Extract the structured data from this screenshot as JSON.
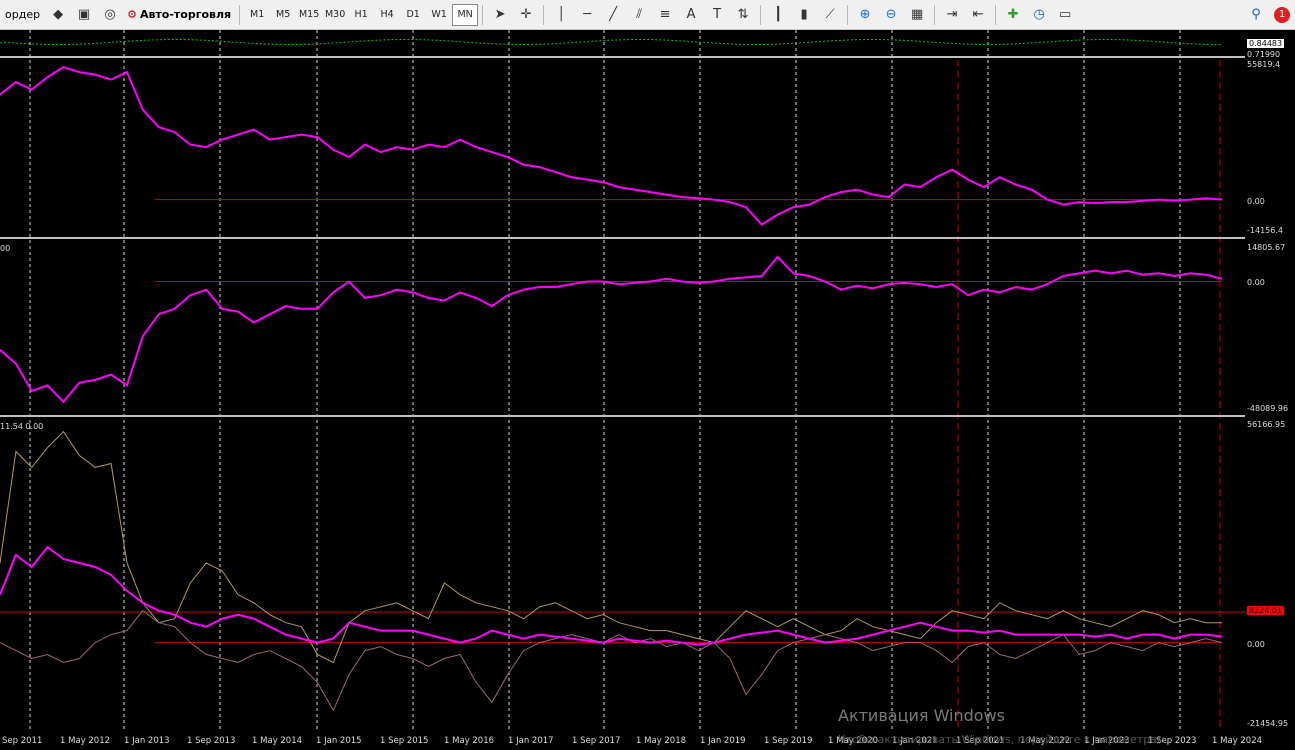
{
  "toolbar": {
    "new_order_label": "ордер",
    "auto_trading_label": "Авто-торговля",
    "timeframes": [
      "M1",
      "M5",
      "M15",
      "M30",
      "H1",
      "H4",
      "D1",
      "W1",
      "MN"
    ],
    "active_timeframe": "MN",
    "notification_count": "1"
  },
  "panes": [
    {
      "id": "pane0",
      "axis_labels": [
        "0.84483",
        "0.71990"
      ]
    },
    {
      "id": "pane1",
      "axis_labels": [
        "55819.4",
        "0.00",
        "-14156.4"
      ]
    },
    {
      "id": "pane2",
      "corner": "00",
      "axis_labels": [
        "14805.67",
        "0.00",
        "-48089.96"
      ]
    },
    {
      "id": "pane3",
      "corner": "11.54 0.00",
      "axis_labels": [
        "56166.95",
        "8224.01",
        "0.00",
        "-21454.95"
      ]
    }
  ],
  "time_axis": [
    "Sep 2011",
    "1 May 2012",
    "1 Jan 2013",
    "1 Sep 2013",
    "1 May 2014",
    "1 Jan 2015",
    "1 Sep 2015",
    "1 May 2016",
    "1 Jan 2017",
    "1 Sep 2017",
    "1 May 2018",
    "1 Jan 2019",
    "1 Sep 2019",
    "1 May 2020",
    "1 Jan 2021",
    "1 Sep 2021",
    "1 May 2022",
    "1 Jan 2023",
    "1 Sep 2023",
    "1 May 2024"
  ],
  "watermark": {
    "title": "Активация Windows",
    "subtitle": "Чтобы активировать Windows, перейдите к параметрам."
  },
  "colors": {
    "main_line": "#ff00ff",
    "zero_line": "#cc0000",
    "grid": "#ffffff",
    "signal_line": "#00cc00",
    "aux_line_1": "#b39a5a",
    "aux_line_2": "#9c6a6a",
    "marker_line": "#cc0000"
  },
  "chart_data": [
    {
      "type": "line",
      "pane": "pane1",
      "x": [
        "Jul 2011",
        "Sep 2011",
        "Nov 2011",
        "Jan 2012",
        "Mar 2012",
        "May 2012",
        "Jul 2012",
        "Sep 2012",
        "Nov 2012",
        "Jan 2013",
        "Mar 2013",
        "May 2013",
        "Jul 2013",
        "Sep 2013",
        "Nov 2013",
        "Jan 2014",
        "Mar 2014",
        "May 2014",
        "Jul 2014",
        "Sep 2014",
        "Nov 2014",
        "Jan 2015",
        "Mar 2015",
        "May 2015",
        "Jul 2015",
        "Sep 2015",
        "Nov 2015",
        "Jan 2016",
        "Mar 2016",
        "May 2016",
        "Jul 2016",
        "Sep 2016",
        "Nov 2016",
        "Jan 2017",
        "Mar 2017",
        "May 2017",
        "Jul 2017",
        "Sep 2017",
        "Nov 2017",
        "Jan 2018",
        "Mar 2018",
        "May 2018",
        "Jul 2018",
        "Sep 2018",
        "Nov 2018",
        "Jan 2019",
        "Mar 2019",
        "May 2019",
        "Jul 2019",
        "Sep 2019",
        "Nov 2019",
        "Jan 2020",
        "Mar 2020",
        "May 2020",
        "Jul 2020",
        "Sep 2020",
        "Nov 2020",
        "Jan 2021",
        "Mar 2021",
        "May 2021",
        "Jul 2021",
        "Sep 2021",
        "Nov 2021",
        "Jan 2022",
        "Mar 2022",
        "May 2022",
        "Jul 2022",
        "Sep 2022",
        "Nov 2022",
        "Jan 2023",
        "Mar 2023",
        "May 2023",
        "Jul 2023",
        "Sep 2023",
        "Nov 2023",
        "Jan 2024",
        "Mar 2024",
        "May 2024"
      ],
      "values": [
        42000,
        47000,
        44000,
        49000,
        53000,
        51000,
        50000,
        48000,
        51000,
        36000,
        29000,
        27000,
        22000,
        21000,
        24000,
        26000,
        28000,
        24000,
        25000,
        26000,
        25000,
        20000,
        17000,
        22000,
        19000,
        21000,
        20000,
        22000,
        21000,
        24000,
        21000,
        19000,
        17000,
        14000,
        13000,
        11000,
        9000,
        8000,
        7000,
        5000,
        4000,
        3000,
        2000,
        1000,
        500,
        0,
        -1000,
        -3000,
        -10000,
        -6000,
        -3000,
        -2000,
        1000,
        3000,
        4000,
        2000,
        1000,
        6000,
        5000,
        9000,
        12000,
        8000,
        5000,
        9000,
        6000,
        4000,
        0,
        -2000,
        -1000,
        -1500,
        -1000,
        -1000,
        -500,
        0,
        -500,
        0,
        500,
        0
      ],
      "ylim": [
        -14156.4,
        55819.4
      ]
    },
    {
      "type": "line",
      "pane": "pane2",
      "values": [
        -25000,
        -30000,
        -40000,
        -38000,
        -44000,
        -37000,
        -36000,
        -34000,
        -38000,
        -20000,
        -12000,
        -10000,
        -5000,
        -3000,
        -10000,
        -11000,
        -15000,
        -12000,
        -9000,
        -10000,
        -10000,
        -4000,
        0,
        -6000,
        -5000,
        -3000,
        -4000,
        -6000,
        -7000,
        -4000,
        -6000,
        -9000,
        -5000,
        -3000,
        -2000,
        -2000,
        -1000,
        0,
        0,
        -1000,
        -500,
        0,
        1000,
        0,
        -500,
        0,
        1000,
        1500,
        2000,
        9000,
        3000,
        2000,
        0,
        -3000,
        -1500,
        -2500,
        -1000,
        -500,
        -1000,
        -2000,
        -1000,
        -5000,
        -3000,
        -4000,
        -2000,
        -3000,
        -1000,
        2000,
        3000,
        4000,
        3000,
        4000,
        2500,
        3000,
        2000,
        3000,
        2500,
        1000
      ],
      "ylim": [
        -48089.96,
        14805.67
      ]
    },
    {
      "type": "line",
      "pane": "pane3",
      "series_colors": [
        "#b39a5a",
        "#9c6a6a",
        "#ff00ff"
      ],
      "series": [
        {
          "values": [
            20000,
            48000,
            44000,
            49000,
            53000,
            47000,
            44000,
            45000,
            20000,
            10000,
            5000,
            6000,
            15000,
            20000,
            18000,
            12000,
            10000,
            7000,
            5000,
            4000,
            -3000,
            -5000,
            5000,
            8000,
            9000,
            10000,
            8000,
            6000,
            15000,
            12000,
            10000,
            9000,
            8000,
            6000,
            9000,
            10000,
            8000,
            6000,
            7000,
            5000,
            4000,
            3000,
            3000,
            2000,
            1000,
            0,
            4000,
            8000,
            6000,
            4000,
            6000,
            4000,
            2000,
            3000,
            6000,
            4000,
            3000,
            2000,
            1000,
            5000,
            8000,
            7000,
            6000,
            10000,
            8000,
            7000,
            6000,
            8000,
            6000,
            5000,
            4000,
            6000,
            8000,
            7000,
            5000,
            6000,
            5000,
            5000
          ]
        },
        {
          "values": [
            0,
            -2000,
            -4000,
            -3000,
            -5000,
            -4000,
            0,
            2000,
            3000,
            8000,
            5000,
            4000,
            0,
            -3000,
            -4000,
            -5000,
            -3000,
            -2000,
            -4000,
            -6000,
            -10000,
            -17000,
            -8000,
            -2000,
            -1000,
            -3000,
            -4000,
            -6000,
            -4000,
            -3000,
            -10000,
            -15000,
            -8000,
            -2000,
            0,
            1000,
            2000,
            1000,
            0,
            2000,
            0,
            1000,
            -1000,
            0,
            -2000,
            0,
            -4000,
            -13000,
            -8000,
            -2000,
            0,
            1000,
            2000,
            1000,
            0,
            -2000,
            -1000,
            0,
            0,
            -2000,
            -5000,
            -1000,
            0,
            -3000,
            -4000,
            -2000,
            0,
            2000,
            -3000,
            -2000,
            0,
            -1000,
            -2000,
            0,
            -1000,
            0,
            1000,
            0
          ]
        },
        {
          "values": [
            12000,
            22000,
            19000,
            24000,
            21000,
            20000,
            19000,
            17000,
            13000,
            10000,
            8000,
            7000,
            5000,
            4000,
            6000,
            7000,
            6000,
            4000,
            2000,
            1000,
            0,
            1000,
            5000,
            4000,
            3000,
            3000,
            3000,
            2000,
            1000,
            0,
            1000,
            3000,
            2000,
            1000,
            2000,
            1500,
            1000,
            500,
            0,
            1000,
            500,
            0,
            500,
            0,
            -500,
            0,
            1000,
            2000,
            2500,
            3000,
            2000,
            1000,
            0,
            500,
            1000,
            2000,
            3000,
            4000,
            5000,
            4000,
            3000,
            3000,
            2500,
            3000,
            2000,
            2000,
            2000,
            2000,
            2000,
            1500,
            2000,
            1000,
            2000,
            2000,
            1000,
            2000,
            2000,
            1500
          ]
        }
      ],
      "ylim": [
        -21454.95,
        56166.95
      ]
    }
  ]
}
